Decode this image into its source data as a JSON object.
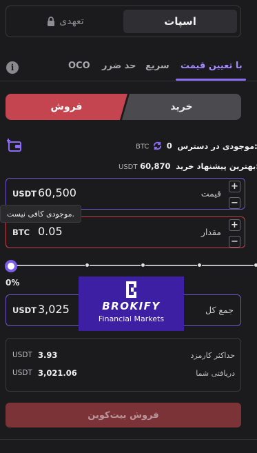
{
  "mode_tabs": {
    "spot": "اسپات",
    "margin": "تعهدی"
  },
  "order_tabs": [
    {
      "label": "با تعیین قیمت",
      "active": true
    },
    {
      "label": "سریع",
      "active": false
    },
    {
      "label": "حد ضرر",
      "active": false
    },
    {
      "label": "OCO",
      "active": false
    }
  ],
  "side_switch": {
    "buy": "خرید",
    "sell": "فروش",
    "selected": "sell"
  },
  "balance": {
    "label": "موجودی در دسترس:",
    "value": "0",
    "unit": "BTC"
  },
  "best_offer": {
    "label": "بهترین پیشنهاد خرید:",
    "value": "60,870",
    "unit": "USDT"
  },
  "price_field": {
    "label": "قیمت",
    "value": "60,500",
    "unit": "USDT"
  },
  "amount_field": {
    "label": "مقدار",
    "value": "0.05",
    "unit": "BTC"
  },
  "error_tooltip": "موجودی کافی نیست.",
  "slider": {
    "percent_text": "0%",
    "value_fraction": 0
  },
  "total_field": {
    "label": "جمع کل",
    "value": "3,025",
    "unit": "USDT"
  },
  "fees": {
    "max_fee_label": "حداکثر کارمزد",
    "max_fee_value": "3.93",
    "max_fee_unit": "USDT",
    "receive_label": "دریافتی شما",
    "receive_value": "3,021.06",
    "receive_unit": "USDT"
  },
  "submit_label": "فروش بیت‌کوین",
  "logo": {
    "word": "BROKIFY",
    "sub": "Financial Markets"
  },
  "colors": {
    "accent": "#8c6cf4",
    "sell": "#c4454f",
    "buy": "#4a4a4f",
    "background": "#1b1b1d"
  }
}
